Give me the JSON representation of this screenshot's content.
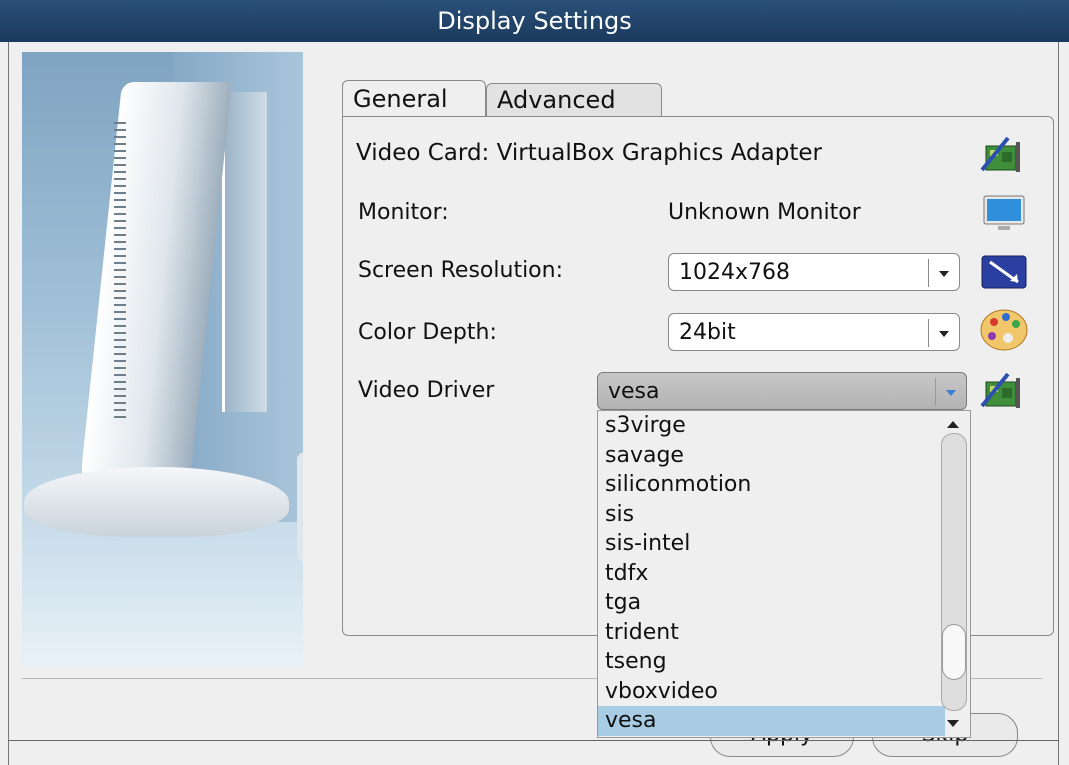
{
  "window": {
    "title": "Display Settings"
  },
  "tabs": [
    {
      "label": "General"
    },
    {
      "label": "Advanced"
    }
  ],
  "general": {
    "video_card_label": "Video Card: VirtualBox Graphics Adapter",
    "monitor_label": "Monitor:",
    "monitor_value": "Unknown Monitor",
    "resolution_label": "Screen Resolution:",
    "resolution_value": "1024x768",
    "depth_label": "Color Depth:",
    "depth_value": "24bit",
    "driver_label": "Video Driver",
    "driver_value": "vesa"
  },
  "driver_options": [
    "s3virge",
    "savage",
    "siliconmotion",
    "sis",
    "sis-intel",
    "tdfx",
    "tga",
    "trident",
    "tseng",
    "vboxvideo",
    "vesa"
  ],
  "buttons": {
    "apply": "Apply",
    "skip": "Skip"
  },
  "icons": {
    "video_card": "graphics-card-icon",
    "monitor": "monitor-icon",
    "resolution": "resolution-icon",
    "depth": "palette-icon",
    "driver": "graphics-card-icon"
  },
  "colors": {
    "titlebar": "#1b3a5d",
    "selection": "#a8cce4"
  }
}
